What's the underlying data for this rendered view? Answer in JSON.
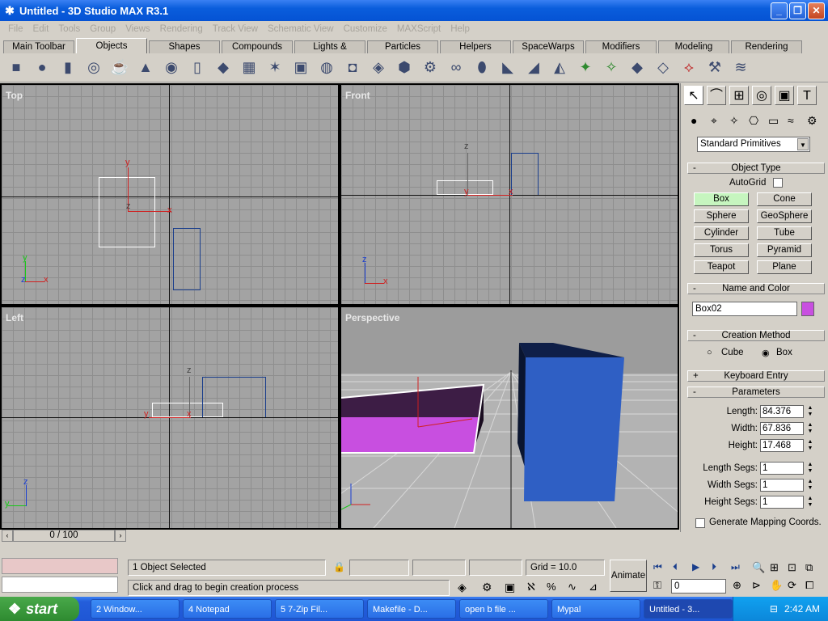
{
  "window": {
    "title": "Untitled - 3D Studio MAX R3.1"
  },
  "menu": [
    "File",
    "Edit",
    "Tools",
    "Group",
    "Views",
    "Rendering",
    "Track View",
    "Schematic View",
    "Customize",
    "MAXScript",
    "Help"
  ],
  "tabs": [
    {
      "label": "Main Toolbar",
      "active": false
    },
    {
      "label": "Objects",
      "active": true
    },
    {
      "label": "Shapes",
      "active": false
    },
    {
      "label": "Compounds",
      "active": false
    },
    {
      "label": "Lights & Cameras",
      "active": false
    },
    {
      "label": "Particles",
      "active": false
    },
    {
      "label": "Helpers",
      "active": false
    },
    {
      "label": "SpaceWarps",
      "active": false
    },
    {
      "label": "Modifiers",
      "active": false
    },
    {
      "label": "Modeling",
      "active": false
    },
    {
      "label": "Rendering",
      "active": false
    }
  ],
  "viewports": {
    "top": {
      "label": "Top"
    },
    "front": {
      "label": "Front"
    },
    "left": {
      "label": "Left"
    },
    "perspective": {
      "label": "Perspective"
    },
    "axis": {
      "x": "x",
      "y": "y",
      "z": "z"
    }
  },
  "command_panel": {
    "category_dropdown": "Standard Primitives",
    "object_type": {
      "header": "Object Type",
      "autogrid": "AutoGrid",
      "buttons": [
        "Box",
        "Cone",
        "Sphere",
        "GeoSphere",
        "Cylinder",
        "Tube",
        "Torus",
        "Pyramid",
        "Teapot",
        "Plane"
      ],
      "selected": "Box"
    },
    "name_color": {
      "header": "Name and Color",
      "name": "Box02",
      "color": "#c84fe0"
    },
    "creation_method": {
      "header": "Creation Method",
      "options": [
        "Cube",
        "Box"
      ],
      "selected": "Box"
    },
    "keyboard_entry": {
      "header": "Keyboard Entry"
    },
    "parameters": {
      "header": "Parameters",
      "fields": [
        {
          "label": "Length:",
          "value": "84.376"
        },
        {
          "label": "Width:",
          "value": "67.836"
        },
        {
          "label": "Height:",
          "value": "17.468"
        },
        {
          "label": "Length Segs:",
          "value": "1"
        },
        {
          "label": "Width Segs:",
          "value": "1"
        },
        {
          "label": "Height Segs:",
          "value": "1"
        }
      ],
      "mapping": "Generate Mapping Coords."
    }
  },
  "timeslider": {
    "value": "0 / 100"
  },
  "status": {
    "selected": "1 Object Selected",
    "prompt": "Click and drag to begin creation process",
    "grid": "Grid = 10.0",
    "animate": "Animate",
    "frame": "0"
  },
  "taskbar": {
    "start": "start",
    "tasks": [
      "2 Window...",
      "4 Notepad",
      "5 7-Zip Fil...",
      "Makefile - D...",
      "open b file ...",
      "Mypal",
      "Untitled - 3..."
    ],
    "active_task": "Untitled - 3...",
    "clock": "2:42 AM"
  },
  "colors": {
    "viewport_bg": "#a3a3a3",
    "selection": "#ffffff",
    "box_purple": "#c84fe0",
    "box_blue": "#2f5fc4"
  }
}
